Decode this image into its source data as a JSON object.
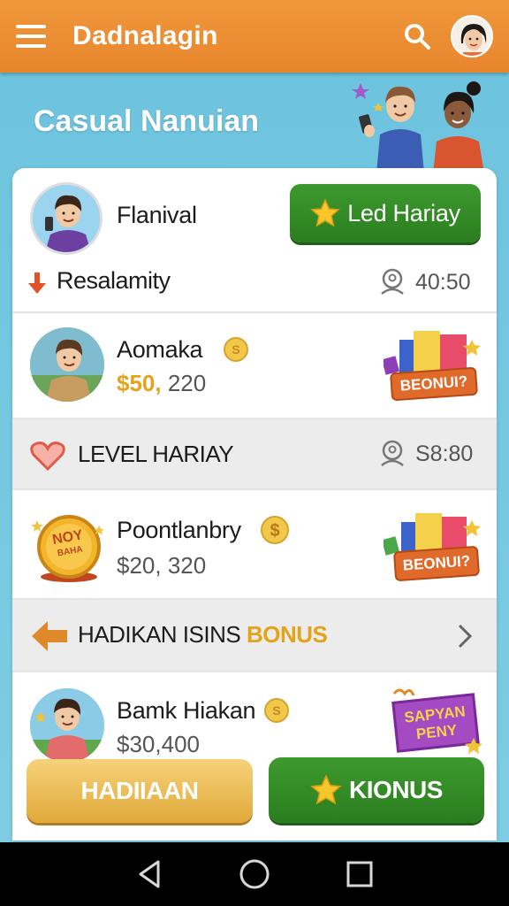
{
  "header": {
    "title": "Dadnalagin",
    "menu_icon": "hamburger-menu-icon",
    "search_icon": "search-icon"
  },
  "hero": {
    "title": "Casual Nanuian"
  },
  "user_row": {
    "name": "Flanival",
    "button_label": "Led Hariay"
  },
  "status_row": {
    "label": "Resalamity",
    "timer": "40:50"
  },
  "rows": [
    {
      "name": "Aomaka",
      "amount_a": "$50,",
      "amount_b": " 220",
      "badge": "BEONUI?"
    },
    {
      "name": "Poontlanbry",
      "amount": "$20, 320",
      "badge": "BEONUI?"
    },
    {
      "name": "Bamk Hiakan",
      "amount": "$30,400",
      "badge_line1": "SAPYAN",
      "badge_line2": "PENY"
    }
  ],
  "level_row": {
    "label": "LEVEL HARIAY",
    "timer": "S8:80"
  },
  "bonus_row": {
    "label_a": "HADIKAN ISINS ",
    "label_b": "BONUS"
  },
  "coin_badge": {
    "line1": "NOY",
    "line2": "BAHA"
  },
  "bottom": {
    "left_button": "HADIIAAN",
    "right_button": "KIONUS"
  },
  "colors": {
    "topbar": "#e8862c",
    "green": "#2b7d1f",
    "gold": "#e3a41b",
    "sky": "#6cc3de"
  }
}
